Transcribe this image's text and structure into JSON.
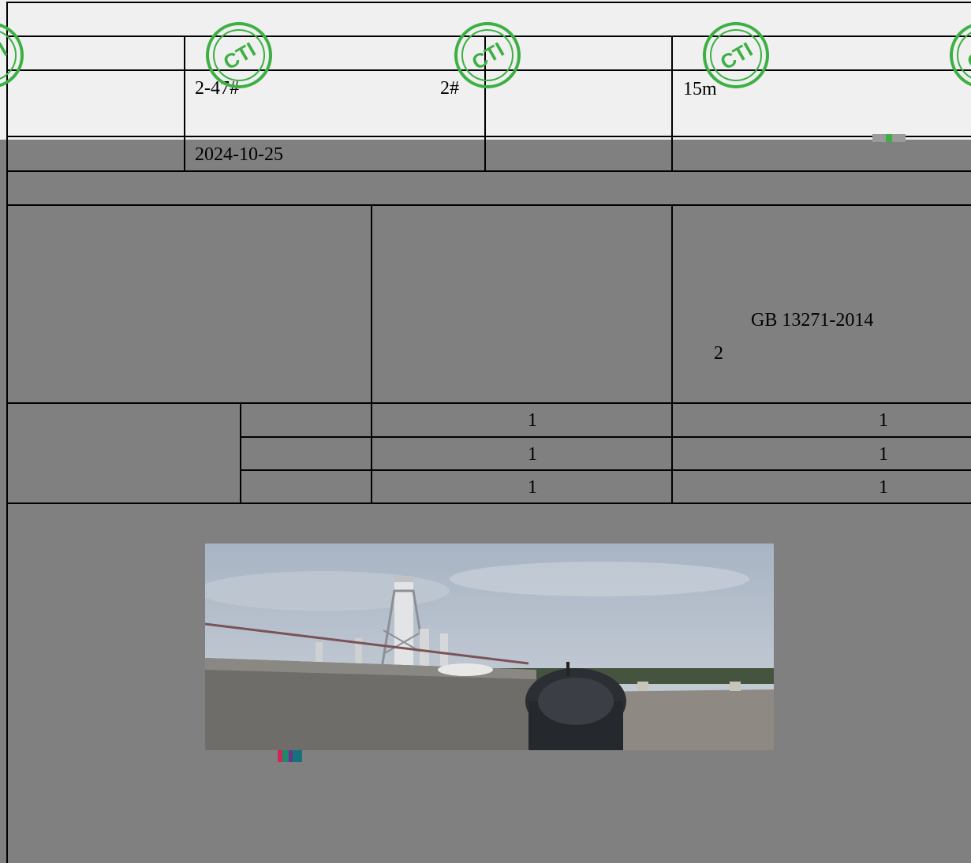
{
  "header": {
    "sample_id": "2-47#",
    "point": "2#",
    "height": "15m",
    "date": "2024-10-25"
  },
  "standard": {
    "code": "GB 13271-2014",
    "level": "2"
  },
  "grid_rows": [
    {
      "a": "1",
      "b": "1"
    },
    {
      "a": "1",
      "b": "1"
    },
    {
      "a": "1",
      "b": "1"
    }
  ],
  "stamp": {
    "text": "CTI",
    "color": "#3cb043"
  },
  "photo": {
    "name": "rooftop-stack-photo"
  }
}
